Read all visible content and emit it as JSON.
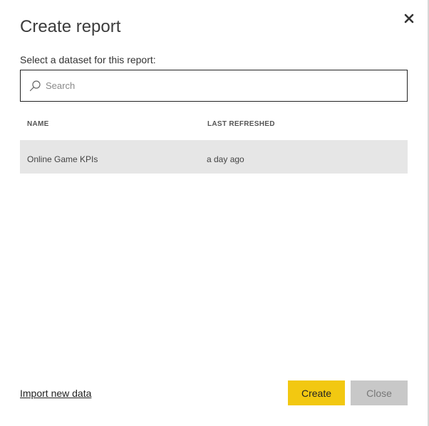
{
  "dialog": {
    "title": "Create report",
    "subtitle": "Select a dataset for this report:",
    "close_icon": "close-icon"
  },
  "search": {
    "placeholder": "Search",
    "value": "",
    "icon": "search-icon"
  },
  "table": {
    "columns": [
      "NAME",
      "LAST REFRESHED"
    ],
    "rows": [
      {
        "name": "Online Game KPIs",
        "last_refreshed": "a day ago",
        "selected": true
      }
    ],
    "selected_row_color": "#e6e6e6"
  },
  "footer": {
    "import_link": "Import new data",
    "create_label": "Create",
    "close_label": "Close",
    "create_color": "#f2c811",
    "close_color": "#c8c8c8"
  }
}
